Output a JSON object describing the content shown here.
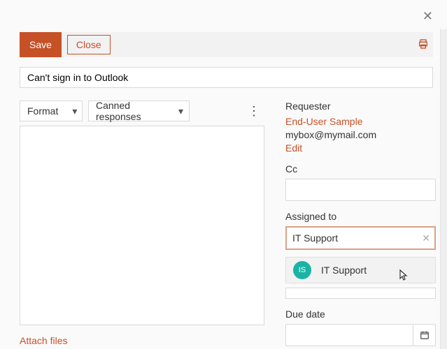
{
  "toolbar": {
    "save_label": "Save",
    "close_label": "Close"
  },
  "subject": "Can't sign in to Outlook",
  "editor": {
    "format_label": "Format",
    "canned_label": "Canned responses"
  },
  "attach_label": "Attach files",
  "sidebar": {
    "requester_label": "Requester",
    "requester_name": "End-User Sample",
    "requester_email": "mybox@mymail.com",
    "edit_label": "Edit",
    "cc_label": "Cc",
    "cc_value": "",
    "assigned_label": "Assigned to",
    "assigned_value": "IT Support",
    "suggestion": {
      "initials": "IS",
      "label": "IT Support"
    },
    "due_label": "Due date",
    "due_value": ""
  }
}
